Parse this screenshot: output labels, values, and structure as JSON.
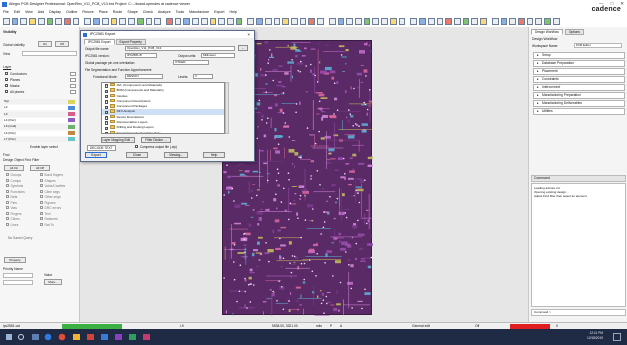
{
  "app": {
    "title": "Allegro PCB Designer Professional: OpenRex_V11_PCB_V13.brd  Project: C:.../board-opendes at cadence viewer",
    "brand": "cadence",
    "menu": [
      "File",
      "Edit",
      "View",
      "Add",
      "Display",
      "Outline",
      "Rmove",
      "Place",
      "Route",
      "Shape",
      "Check",
      "Analyze",
      "Tools",
      "Manufacture",
      "Export",
      "Help"
    ]
  },
  "left_panel": {
    "visibility_label": "Visibility",
    "global_visibility_label": "Global visibility",
    "on_label": "On",
    "off_label": "Off",
    "view_label": "View",
    "layer_label": "Layer",
    "sections": [
      "Conductors",
      "Planes",
      "Masks",
      "All planes"
    ],
    "layers": [
      {
        "name": "Top",
        "color": "#d9d45a"
      },
      {
        "name": "L2",
        "color": "#4d8cd8"
      },
      {
        "name": "L3",
        "color": "#d45f8a"
      },
      {
        "name": "L4 (Pwr)",
        "color": "#8f5cc2"
      },
      {
        "name": "L5 (Gnd)",
        "color": "#6bb36b"
      },
      {
        "name": "L6 (Pwr)",
        "color": "#c58640"
      },
      {
        "name": "L7 (Pwr)",
        "color": "#64c7c4"
      }
    ],
    "enable_layer_select": "Enable layer select",
    "find_label": "Find",
    "design_object_find": "Design Object Find Filter",
    "all_on": "All On",
    "all_off": "All Off",
    "find_items": [
      "Groups",
      "Comps",
      "Symbols",
      "Functions",
      "Nets",
      "Pins",
      "Vias",
      "Fingers",
      "Clines",
      "Lines"
    ],
    "find_items_right": [
      "Bond fingers",
      "Shapes",
      "Voids/Cavities",
      "Cline segs",
      "Other segs",
      "Figures",
      "DRC errors",
      "Text",
      "Ratsnest",
      "Rat Ts"
    ],
    "saved_query": "No Saved Query",
    "property_label": "Property",
    "property_value": "Property",
    "priority_label": "Priority Name",
    "value_label": "Value",
    "more_label": "More..."
  },
  "dialog": {
    "title": "IPC2581 Export",
    "tabs": [
      "IPC2581 Export",
      "Export Property"
    ],
    "output_file_label": "Output file name:",
    "output_file_value": "OpenRex_V11_PCB_V13",
    "version_label": "IPC2581 version:",
    "version_value": "IPC2581-B",
    "units_label": "Output units:",
    "units_value": "Millimeter",
    "global_label": "Global package pin one orientation:",
    "global_value": "OTHER",
    "segmentation_label": "File Segmentation and Function Apportionment",
    "functional_mode_label": "Functional Mode:",
    "functional_mode_value": "DESIGN",
    "levels_label": "Levels:",
    "levels_value": "3",
    "items": [
      {
        "label": "AVL (Components and Materials)",
        "checked": true,
        "selected": false
      },
      {
        "label": "BOM (Components and Materials)",
        "checked": true,
        "selected": false
      },
      {
        "label": "Cavities",
        "checked": true,
        "selected": false
      },
      {
        "label": "Component Descriptions",
        "checked": true,
        "selected": false
      },
      {
        "label": "Component Packages",
        "checked": true,
        "selected": false
      },
      {
        "label": "DFX Analysis",
        "checked": true,
        "selected": true
      },
      {
        "label": "Device Descriptions",
        "checked": true,
        "selected": false
      },
      {
        "label": "Documentation Layers",
        "checked": true,
        "selected": false
      },
      {
        "label": "Drilling and Routing Layers",
        "checked": true,
        "selected": false
      },
      {
        "label": "Export Cross Section Data Only",
        "checked": true,
        "selected": false
      },
      {
        "label": "Hierarchical Conductor Routing Files",
        "checked": true,
        "selected": false
      },
      {
        "label": "Hierarchical Layer Stack-Ups ...",
        "checked": true,
        "selected": false
      }
    ],
    "layer_mapping_btn": "Layer Mapping Edit ...",
    "filter_btn": "Filter Diction ...",
    "decode_label": "DECODE TEXT",
    "compress_label": "Compress output file (.zip)",
    "export_btn": "Export",
    "close_btn": "Close",
    "viewlog_btn": "Viewlog...",
    "help_btn": "Help",
    "close_x": "×"
  },
  "right_panel": {
    "tabs": [
      "Design Workflow",
      "Options"
    ],
    "header": "Design Workflow",
    "workspace_label": "Workspace Name:",
    "workspace_value": "PCB Editor",
    "workflow_items": [
      "Setup",
      "Database Preparation",
      "Placement",
      "Constraints",
      "Interconnect",
      "Manufacturing Preparation",
      "Manufacturing Deliverables",
      "Utilities"
    ],
    "command_header": "Command",
    "command_lines": [
      "Loading axlcore.cxt",
      "Opening existing design...",
      "Adjust Find filter then select an element."
    ],
    "command_prompt": "Command >"
  },
  "status": {
    "left": "ipc2581 out",
    "layer": "L9",
    "coords": "5538.00, 3321.00",
    "units": "mils",
    "p_label": "P",
    "a_label": "A",
    "mode": "General edit",
    "off": "Off",
    "fire_count": "0"
  },
  "taskbar": {
    "time": "12:11 PM",
    "date": "12/18/2019"
  },
  "colors": {
    "board": "#5a2a66",
    "accent": "#2a6fd6",
    "status_green": "#3cb043",
    "status_red": "#e02020"
  }
}
